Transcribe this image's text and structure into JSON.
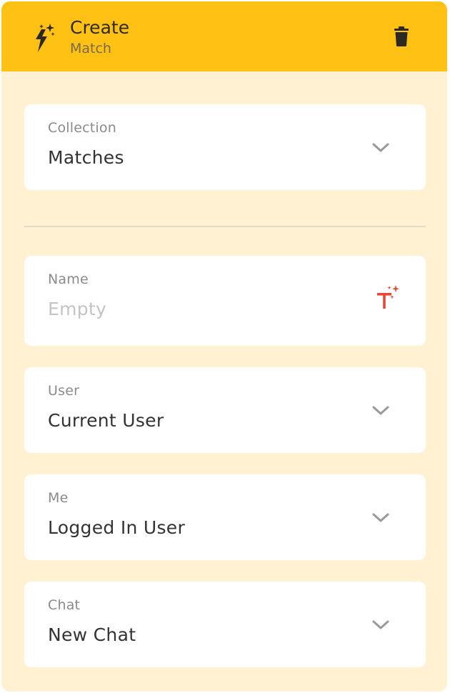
{
  "header": {
    "title": "Create",
    "subtitle": "Match",
    "icon": "magic-bolt-icon",
    "delete_icon": "trash-icon",
    "color": "#ffc114"
  },
  "fields": [
    {
      "label": "Collection",
      "value": "Matches",
      "control": "dropdown"
    },
    {
      "label": "Name",
      "placeholder": "Empty",
      "control": "text-magic"
    },
    {
      "label": "User",
      "value": "Current User",
      "control": "dropdown"
    },
    {
      "label": "Me",
      "value": "Logged In User",
      "control": "dropdown"
    },
    {
      "label": "Chat",
      "value": "New Chat",
      "control": "dropdown"
    }
  ],
  "colors": {
    "panel_background": "#fff1d2",
    "magic_text_icon": "#e8483a"
  }
}
